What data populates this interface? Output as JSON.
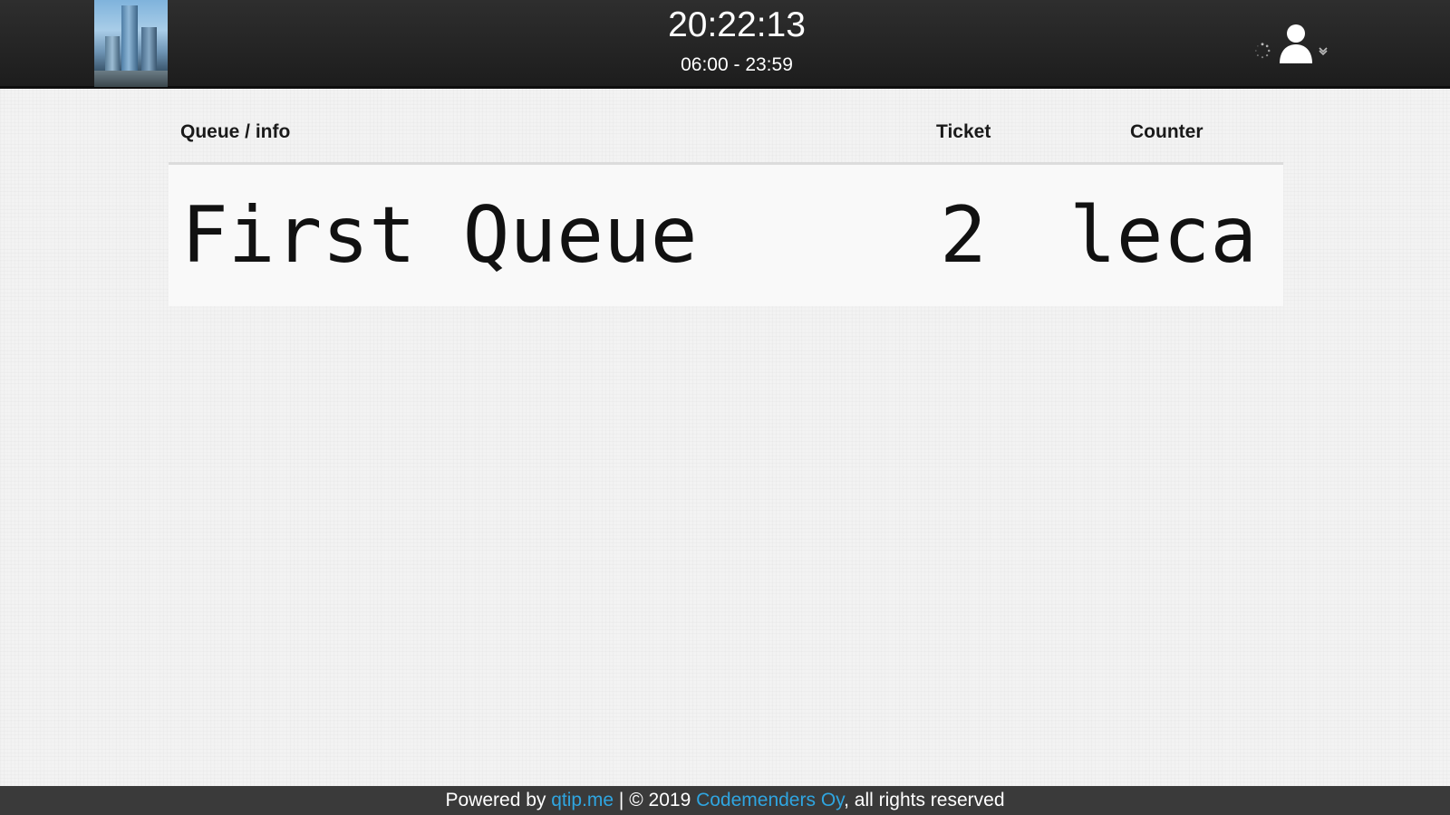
{
  "header": {
    "clock": "20:22:13",
    "opening_hours": "06:00 - 23:59"
  },
  "table": {
    "headers": {
      "queue": "Queue / info",
      "ticket": "Ticket",
      "counter": "Counter"
    },
    "rows": [
      {
        "queue": "First Queue",
        "ticket": "2",
        "counter": "leca"
      }
    ]
  },
  "footer": {
    "prefix": "Powered by ",
    "brand_link": "qtip.me",
    "middle": " | © 2019 ",
    "company_link": "Codemenders Oy",
    "suffix": ", all rights reserved",
    "link_color": "#2fa5e0"
  },
  "icons": {
    "logo": "building-logo",
    "loading": "spinner-icon",
    "user": "user-icon",
    "menu": "chevron-down-icon"
  }
}
